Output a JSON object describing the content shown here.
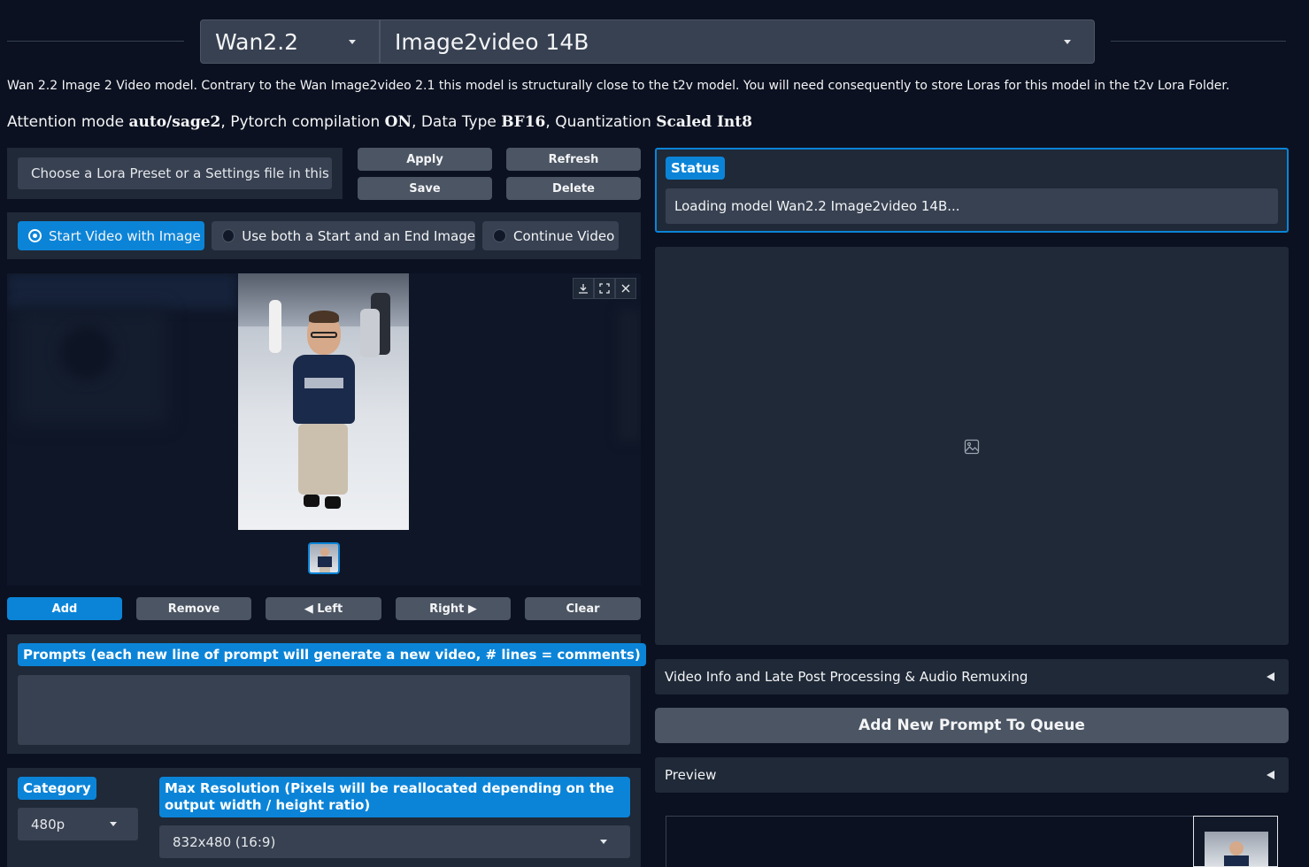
{
  "top": {
    "family": "Wan2.2",
    "model": "Image2video 14B"
  },
  "description": "Wan 2.2 Image 2 Video model. Contrary to the Wan Image2video 2.1 this model is structurally close to the t2v model. You will need consequently to store Loras for this model in the t2v Lora Folder.",
  "attention": {
    "p1": "Attention mode ",
    "mode": "auto/sage2",
    "p2": ", Pytorch compilation ",
    "compile": "ON",
    "p3": ", Data Type ",
    "dtype": "BF16",
    "p4": ", Quantization ",
    "quant": "Scaled Int8"
  },
  "lora": {
    "placeholder": "Choose a Lora Preset or a Settings file in this l",
    "apply": "Apply",
    "refresh": "Refresh",
    "save": "Save",
    "delete": "Delete"
  },
  "status": {
    "label": "Status",
    "text": "Loading model Wan2.2 Image2video 14B..."
  },
  "mode_options": [
    {
      "label": "Start Video with Image",
      "selected": true
    },
    {
      "label": "Use both a Start and an End Image",
      "selected": false
    },
    {
      "label": "Continue Video",
      "selected": false
    }
  ],
  "gallery_buttons": {
    "add": "Add",
    "remove": "Remove",
    "left": "◀ Left",
    "right": "Right ▶",
    "clear": "Clear"
  },
  "prompts": {
    "label": "Prompts (each new line of prompt will generate a new video, # lines = comments)"
  },
  "category": {
    "label": "Category",
    "value": "480p"
  },
  "resolution": {
    "label": "Max Resolution (Pixels will be reallocated depending on the output width / height ratio)",
    "value": "832x480 (16:9)"
  },
  "video_info": "Video Info and Late Post Processing & Audio Remuxing",
  "add_queue": "Add New Prompt To Queue",
  "preview": "Preview",
  "colors": {
    "accent": "#0b84d8",
    "background": "#0b1120",
    "panel": "#1f2937",
    "input": "#374151"
  }
}
